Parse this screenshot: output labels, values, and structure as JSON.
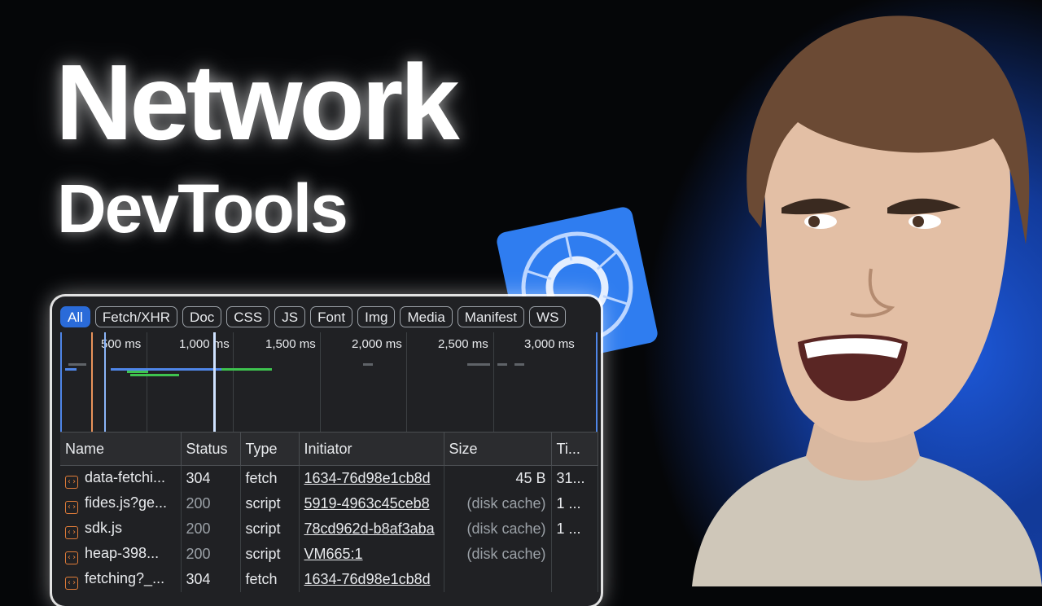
{
  "hero": {
    "title": "Network",
    "subtitle": "DevTools"
  },
  "colors": {
    "accent": "#2a6bd9",
    "background": "#050608",
    "glow": "#1d58d8",
    "file_icon": "#e07c39"
  },
  "devtools": {
    "filters": [
      {
        "label": "All",
        "active": true
      },
      {
        "label": "Fetch/XHR",
        "active": false
      },
      {
        "label": "Doc",
        "active": false
      },
      {
        "label": "CSS",
        "active": false
      },
      {
        "label": "JS",
        "active": false
      },
      {
        "label": "Font",
        "active": false
      },
      {
        "label": "Img",
        "active": false
      },
      {
        "label": "Media",
        "active": false
      },
      {
        "label": "Manifest",
        "active": false
      },
      {
        "label": "WS",
        "active": false
      }
    ],
    "timeline_ticks": [
      "500 ms",
      "1,000 ms",
      "1,500 ms",
      "2,000 ms",
      "2,500 ms",
      "3,000 ms"
    ],
    "columns": [
      "Name",
      "Status",
      "Type",
      "Initiator",
      "Size",
      "Ti..."
    ],
    "rows": [
      {
        "name": "data-fetchi...",
        "status": "304",
        "type": "fetch",
        "initiator": "1634-76d98e1cb8d",
        "size": "45 B",
        "time": "31..."
      },
      {
        "name": "fides.js?ge...",
        "status": "200",
        "type": "script",
        "initiator": "5919-4963c45ceb8",
        "size": "(disk cache)",
        "time": "1 ..."
      },
      {
        "name": "sdk.js",
        "status": "200",
        "type": "script",
        "initiator": "78cd962d-b8af3aba",
        "size": "(disk cache)",
        "time": "1 ..."
      },
      {
        "name": "heap-398...",
        "status": "200",
        "type": "script",
        "initiator": "VM665:1",
        "size": "(disk cache)",
        "time": ""
      },
      {
        "name": "fetching?_...",
        "status": "304",
        "type": "fetch",
        "initiator": "1634-76d98e1cb8d",
        "size": "",
        "time": ""
      }
    ]
  }
}
